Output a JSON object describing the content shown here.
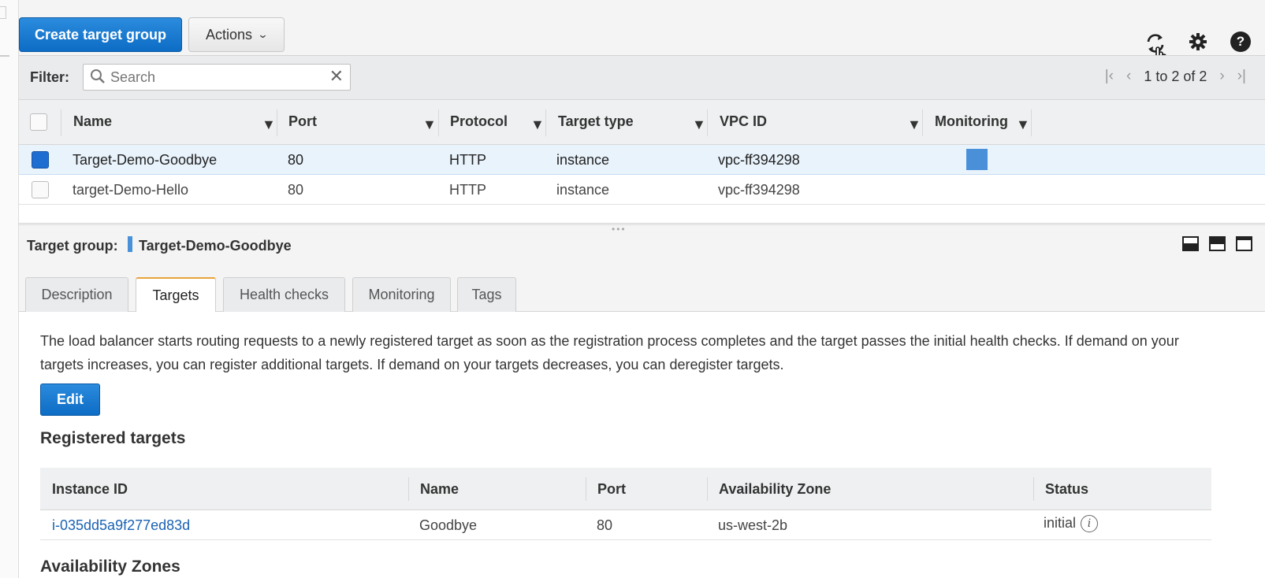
{
  "toolbar": {
    "create_label": "Create target group",
    "actions_label": "Actions",
    "actions_chevron": "⌄"
  },
  "filter": {
    "label": "Filter:",
    "placeholder": "Search",
    "clear_symbol": "✕"
  },
  "pager": {
    "first": "|‹",
    "prev": "‹",
    "count": "1 to 2 of 2",
    "next": "›",
    "last": "›|"
  },
  "grid": {
    "columns": [
      "Name",
      "Port",
      "Protocol",
      "Target type",
      "VPC ID",
      "Monitoring"
    ],
    "rows": [
      {
        "name": "Target-Demo-Goodbye",
        "port": "80",
        "protocol": "HTTP",
        "target_type": "instance",
        "vpc_id": "vpc-ff394298",
        "selected": true
      },
      {
        "name": "target-Demo-Hello",
        "port": "80",
        "protocol": "HTTP",
        "target_type": "instance",
        "vpc_id": "vpc-ff394298",
        "selected": false
      }
    ]
  },
  "detail": {
    "label": "Target group:",
    "name": "Target-Demo-Goodbye"
  },
  "tabs": [
    "Description",
    "Targets",
    "Health checks",
    "Monitoring",
    "Tags"
  ],
  "active_tab": "Targets",
  "targets_panel": {
    "description": "The load balancer starts routing requests to a newly registered target as soon as the registration process completes and the target passes the initial health checks. If demand on your targets increases, you can register additional targets. If demand on your targets decreases, you can deregister targets.",
    "edit_label": "Edit",
    "registered_title": "Registered targets",
    "columns": [
      "Instance ID",
      "Name",
      "Port",
      "Availability Zone",
      "Status"
    ],
    "rows": [
      {
        "instance_id": "i-035dd5a9f277ed83d",
        "name": "Goodbye",
        "port": "80",
        "az": "us-west-2b",
        "status": "initial"
      }
    ],
    "next_section": "Availability Zones"
  },
  "icons": {
    "refresh": "refresh-icon",
    "settings": "gear-icon",
    "help": "help-icon",
    "search": "search-icon",
    "info": "info-icon"
  },
  "colors": {
    "primary": "#1e6ed1",
    "active_tab": "#e8a33a",
    "link": "#1a62b4",
    "monitoring": "#4a90d9"
  }
}
